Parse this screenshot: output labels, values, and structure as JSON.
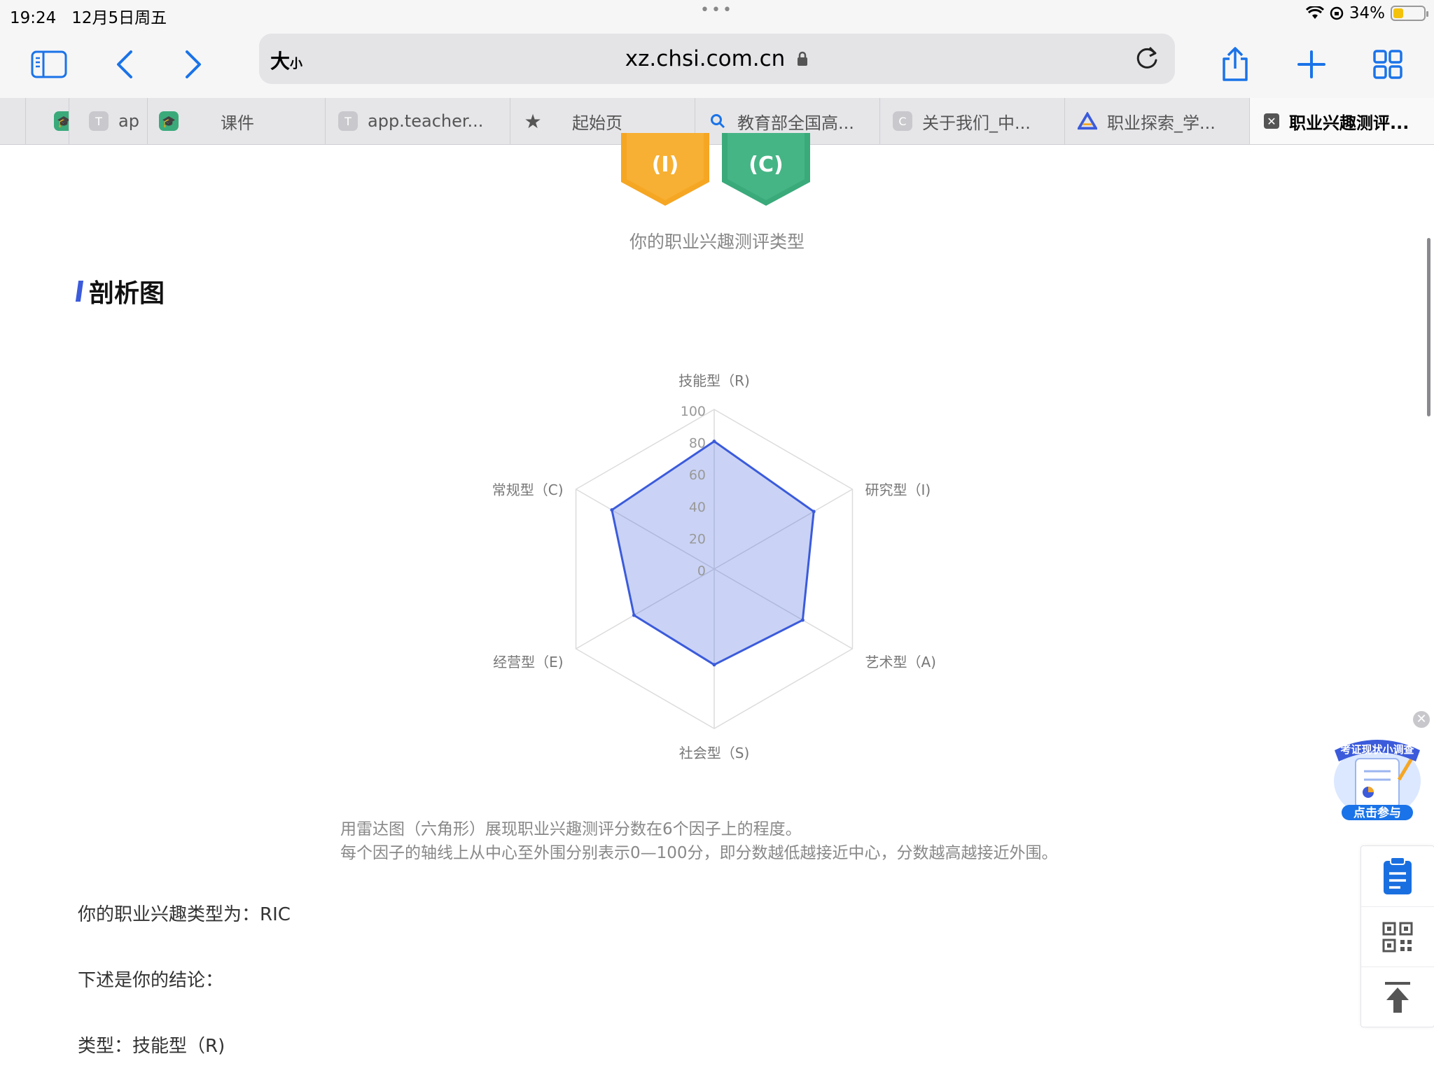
{
  "status_bar": {
    "time": "19:24",
    "date": "12月5日周五",
    "battery": "34%",
    "battery_level": 0.34
  },
  "browser": {
    "address_left_label": "大",
    "address_left_small": "小",
    "url": "xz.chsi.com.cn",
    "tabs": [
      {
        "label": "ap",
        "icon": "T"
      },
      {
        "label": "课件",
        "icon": "graduation-cap"
      },
      {
        "label": "app.teacher...",
        "icon": "T"
      },
      {
        "label": "起始页",
        "icon": "star"
      },
      {
        "label": "教育部全国高...",
        "icon": "search"
      },
      {
        "label": "关于我们_中...",
        "icon": "C"
      },
      {
        "label": "职业探索_学...",
        "icon": "triangle-logo"
      },
      {
        "label": "职业兴趣测评...",
        "icon": "close"
      }
    ]
  },
  "badges": [
    {
      "text": "(I)",
      "color": "#f5a623"
    },
    {
      "text": "(C)",
      "color": "#3aaa7a"
    }
  ],
  "type_caption": "你的职业兴趣测评类型",
  "section_title": "剖析图",
  "chart_data": {
    "type": "radar",
    "axes": [
      "技能型（R)",
      "研究型（I)",
      "艺术型（A)",
      "社会型（S)",
      "经营型（E)",
      "常规型（C)"
    ],
    "ticks": [
      "0",
      "20",
      "40",
      "60",
      "80",
      "100"
    ],
    "range": [
      0,
      100
    ],
    "series": [
      {
        "values": [
          80,
          72,
          64,
          60,
          58,
          74
        ],
        "color": "#3b5bdb"
      }
    ]
  },
  "description": [
    "用雷达图（六角形）展现职业兴趣测评分数在6个因子上的程度。",
    "每个因子的轴线上从中心至外围分别表示0—100分，即分数越低越接近中心，分数越高越接近外围。"
  ],
  "result": {
    "type_line": "你的职业兴趣类型为：RIC",
    "conclusion_line": "下述是你的结论：",
    "category_line": "类型：技能型（R)"
  },
  "survey_widget": {
    "title": "考证现状小调查",
    "cta": "点击参与"
  },
  "side_icons": [
    "clipboard-icon",
    "qr-code-icon",
    "back-to-top-icon"
  ]
}
